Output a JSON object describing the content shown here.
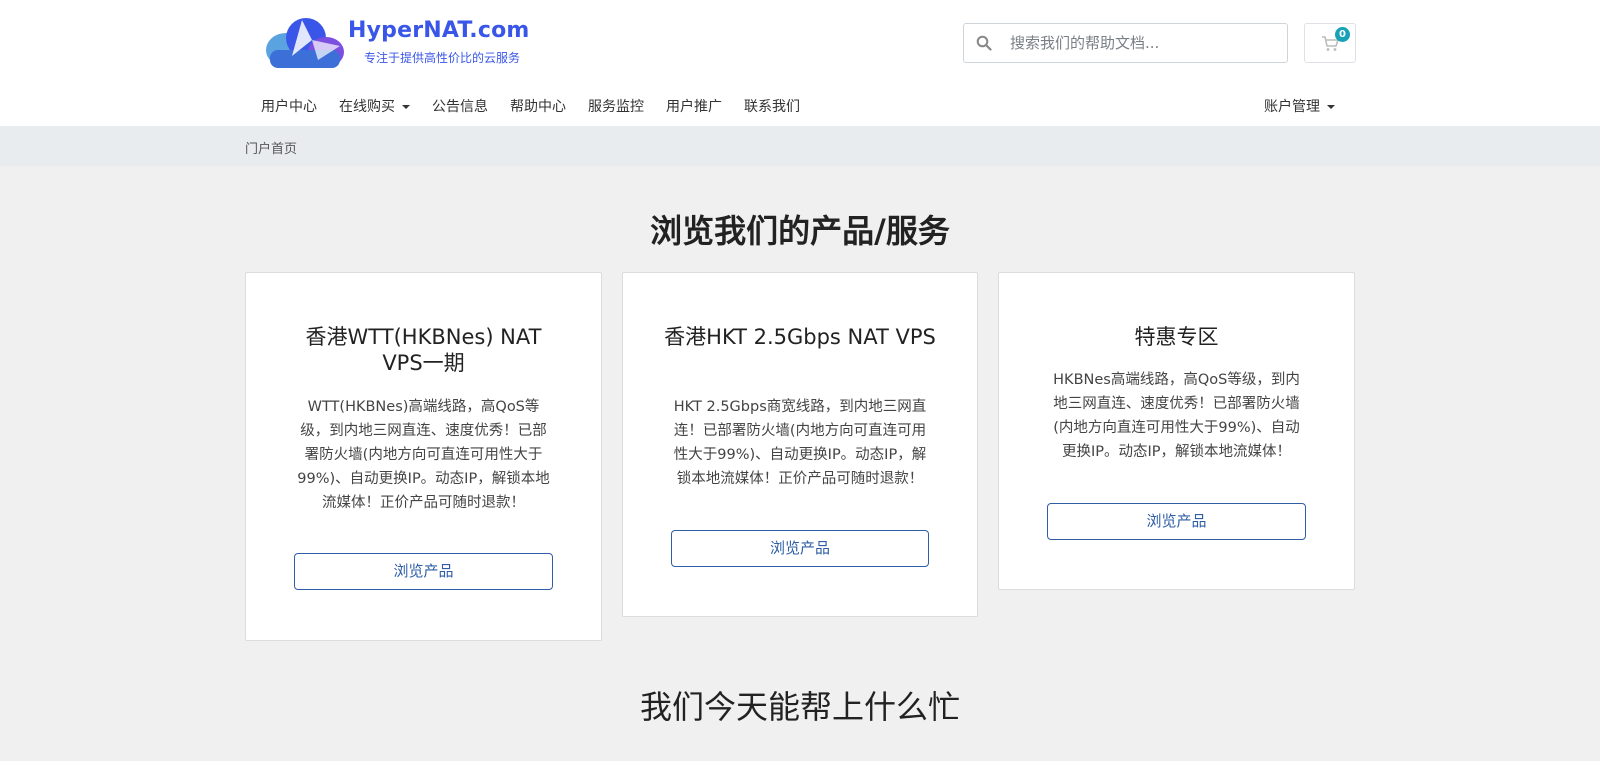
{
  "header": {
    "logo_title": "HyperNAT.com",
    "logo_subtitle": "专注于提供高性价比的云服务",
    "search": {
      "placeholder": "搜索我们的帮助文档..."
    },
    "cart": {
      "count": "0"
    }
  },
  "nav": {
    "items": [
      {
        "label": "用户中心"
      },
      {
        "label": "在线购买",
        "dropdown": true
      },
      {
        "label": "公告信息"
      },
      {
        "label": "帮助中心"
      },
      {
        "label": "服务监控"
      },
      {
        "label": "用户推广"
      },
      {
        "label": "联系我们"
      }
    ],
    "account_label": "账户管理"
  },
  "breadcrumb": {
    "label": "门户首页"
  },
  "products_section": {
    "title": "浏览我们的产品/服务",
    "cards": [
      {
        "title": "香港WTT(HKBNes) NAT VPS一期",
        "description": "WTT(HKBNes)高端线路，高QoS等级，到内地三网直连、速度优秀！已部署防火墙(内地方向可直连可用性大于99%)、自动更换IP。动态IP，解锁本地流媒体！正价产品可随时退款！",
        "button": "浏览产品"
      },
      {
        "title": "香港HKT 2.5Gbps NAT VPS",
        "description": "HKT 2.5Gbps商宽线路，到内地三网直连！已部署防火墙(内地方向可直连可用性大于99%)、自动更换IP。动态IP，解锁本地流媒体！正价产品可随时退款！",
        "button": "浏览产品"
      },
      {
        "title": "特惠专区",
        "description": "HKBNes高端线路，高QoS等级，到内地三网直连、速度优秀！已部署防火墙(内地方向直连可用性大于99%)、自动更换IP。动态IP，解锁本地流媒体！",
        "button": "浏览产品"
      }
    ]
  },
  "help_section": {
    "title": "我们今天能帮上什么忙"
  },
  "colors": {
    "accent": "#2e5ea5",
    "logo": "#3a56e8",
    "badge": "#17a2b8",
    "background": "#f0f0f0"
  }
}
